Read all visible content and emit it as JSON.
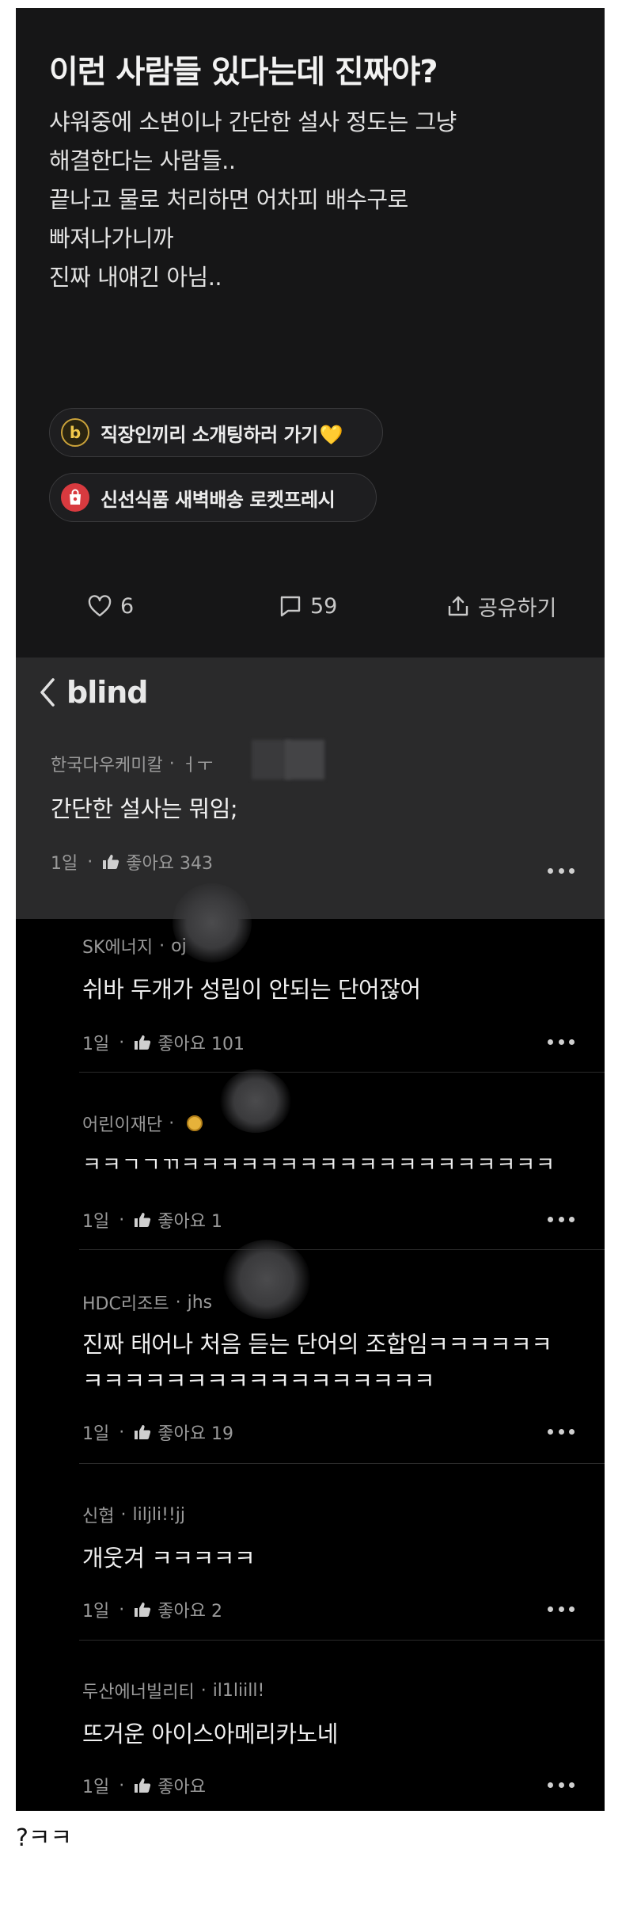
{
  "post": {
    "title": "이런 사람들 있다는데 진짜야?",
    "body_lines": [
      "샤워중에 소변이나 간단한 설사 정도는 그냥",
      "해결한다는 사람들..",
      "끝나고 물로 처리하면 어차피 배수구로",
      "빠져나가니까",
      "진짜 내얘긴 아님.."
    ],
    "ads": [
      {
        "icon": "blind-b-icon",
        "icon_char": "b",
        "label": "직장인끼리 소개팅하러 가기",
        "emoji": "💛"
      },
      {
        "icon": "shopping-bag-icon",
        "label": "신선식품 새벽배송 로켓프레시"
      }
    ],
    "actions": {
      "like_count": "6",
      "comment_count": "59",
      "share_label": "공유하기"
    }
  },
  "app": {
    "brand": "blind"
  },
  "comment": {
    "company": "한국다우케미칼",
    "nickname": "ㅓㅜ",
    "text": "간단한 설사는 뭐임;",
    "age": "1일",
    "like_label": "좋아요 343"
  },
  "replies": [
    {
      "company": "SK에너지",
      "nickname": "oj",
      "lines": [
        "쉬바 두개가 성립이 안되는 단어잖어"
      ],
      "age": "1일",
      "like_label": "좋아요 101"
    },
    {
      "company": "어린이재단",
      "nickname": "",
      "lines": [
        "ㅋㅋㄱㄱㄲㅋㅋㅋㅋㅋㅋㅋㅋㅋㅋㅋㅋㅋㅋㅋㅋㅋㅋㅋ"
      ],
      "age": "1일",
      "like_label": "좋아요 1"
    },
    {
      "company": "HDC리조트",
      "nickname": "jhs",
      "lines": [
        "진짜 태어나 처음 듣는 단어의 조합임ㅋㅋㅋㅋㅋㅋ",
        "ㅋㅋㅋㅋㅋㅋㅋㅋㅋㅋㅋㅋㅋㅋㅋㅋㅋ"
      ],
      "age": "1일",
      "like_label": "좋아요 19"
    },
    {
      "company": "신협",
      "nickname": "liljli!!jj",
      "lines": [
        "개웃겨 ㅋㅋㅋㅋㅋ"
      ],
      "age": "1일",
      "like_label": "좋아요 2"
    },
    {
      "company": "두산에너빌리티",
      "nickname": "il1liill!",
      "lines": [
        "뜨거운 아이스아메리카노네"
      ],
      "age": "1일",
      "like_label": "좋아요"
    }
  ],
  "caption": "?ㅋㅋ"
}
